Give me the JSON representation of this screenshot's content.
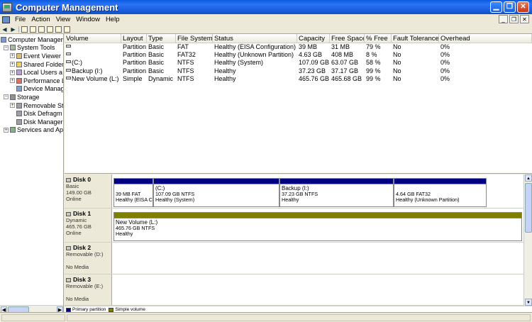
{
  "window": {
    "title": "Computer Management"
  },
  "menu": [
    "File",
    "Action",
    "View",
    "Window",
    "Help"
  ],
  "toolbar": [
    "back-icon",
    "forward-icon",
    "up-folder-icon",
    "show-hide-tree-icon",
    "properties-icon",
    "help-icon",
    "export-icon",
    "refresh-icon"
  ],
  "tree": [
    {
      "label": "Computer Managem",
      "indent": 0,
      "exp": "",
      "icon": "root"
    },
    {
      "label": "System Tools",
      "indent": 1,
      "exp": "−",
      "icon": "tools"
    },
    {
      "label": "Event Viewer",
      "indent": 2,
      "exp": "+",
      "icon": "log"
    },
    {
      "label": "Shared Folder",
      "indent": 2,
      "exp": "+",
      "icon": "folder"
    },
    {
      "label": "Local Users a",
      "indent": 2,
      "exp": "+",
      "icon": "users"
    },
    {
      "label": "Performance L",
      "indent": 2,
      "exp": "+",
      "icon": "perf"
    },
    {
      "label": "Device Manag",
      "indent": 2,
      "exp": "",
      "icon": "dev"
    },
    {
      "label": "Storage",
      "indent": 1,
      "exp": "−",
      "icon": "store"
    },
    {
      "label": "Removable St",
      "indent": 2,
      "exp": "+",
      "icon": "disk"
    },
    {
      "label": "Disk Defragm",
      "indent": 2,
      "exp": "",
      "icon": "disk"
    },
    {
      "label": "Disk Manager",
      "indent": 2,
      "exp": "",
      "icon": "disk"
    },
    {
      "label": "Services and App",
      "indent": 1,
      "exp": "+",
      "icon": "svc"
    }
  ],
  "volume_columns": [
    "Volume",
    "Layout",
    "Type",
    "File System",
    "Status",
    "Capacity",
    "Free Space",
    "% Free",
    "Fault Tolerance",
    "Overhead"
  ],
  "volumes": [
    [
      "",
      "Partition",
      "Basic",
      "FAT",
      "Healthy (EISA Configuration)",
      "39 MB",
      "31 MB",
      "79 %",
      "No",
      "0%"
    ],
    [
      "",
      "Partition",
      "Basic",
      "FAT32",
      "Healthy (Unknown Partition)",
      "4.63 GB",
      "408 MB",
      "8 %",
      "No",
      "0%"
    ],
    [
      "(C:)",
      "Partition",
      "Basic",
      "NTFS",
      "Healthy (System)",
      "107.09 GB",
      "63.07 GB",
      "58 %",
      "No",
      "0%"
    ],
    [
      "Backup (I:)",
      "Partition",
      "Basic",
      "NTFS",
      "Healthy",
      "37.23 GB",
      "37.17 GB",
      "99 %",
      "No",
      "0%"
    ],
    [
      "New Volume (L:)",
      "Simple",
      "Dynamic",
      "NTFS",
      "Healthy",
      "465.76 GB",
      "465.68 GB",
      "99 %",
      "No",
      "0%"
    ]
  ],
  "disks": [
    {
      "name": "Disk 0",
      "lines": [
        "Basic",
        "149.00 GB",
        "Online"
      ],
      "partitions": [
        {
          "name": "",
          "l1": "39 MB FAT",
          "l2": "Healthy (EISA C",
          "color": "#000080"
        },
        {
          "name": "(C:)",
          "l1": "107.09 GB NTFS",
          "l2": "Healthy (System)",
          "color": "#000080"
        },
        {
          "name": "Backup  (I:)",
          "l1": "37.23 GB NTFS",
          "l2": "Healthy",
          "color": "#000080"
        },
        {
          "name": "",
          "l1": "4.64 GB FAT32",
          "l2": "Healthy (Unknown Partition)",
          "color": "#000080"
        }
      ]
    },
    {
      "name": "Disk 1",
      "lines": [
        "Dynamic",
        "465.76 GB",
        "Online"
      ],
      "partitions": [
        {
          "name": "New Volume  (L:)",
          "l1": "465.76 GB NTFS",
          "l2": "Healthy",
          "color": "#808000"
        }
      ]
    },
    {
      "name": "Disk 2",
      "lines": [
        "Removable (D:)",
        "",
        "No Media"
      ],
      "partitions": []
    },
    {
      "name": "Disk 3",
      "lines": [
        "Removable (E:)",
        "",
        "No Media"
      ],
      "partitions": []
    }
  ],
  "legend": [
    {
      "label": "Primary partition",
      "color": "#000080"
    },
    {
      "label": "Simple volume",
      "color": "#808000"
    }
  ]
}
